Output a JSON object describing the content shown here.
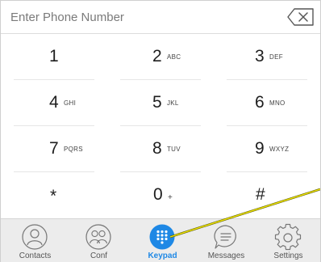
{
  "entry": {
    "placeholder": "Enter Phone Number",
    "value": "",
    "backspace_icon": "backspace-icon"
  },
  "keypad": {
    "keys": [
      {
        "digit": "1",
        "letters": ""
      },
      {
        "digit": "2",
        "letters": "ABC"
      },
      {
        "digit": "3",
        "letters": "DEF"
      },
      {
        "digit": "4",
        "letters": "GHI"
      },
      {
        "digit": "5",
        "letters": "JKL"
      },
      {
        "digit": "6",
        "letters": "MNO"
      },
      {
        "digit": "7",
        "letters": "PQRS"
      },
      {
        "digit": "8",
        "letters": "TUV"
      },
      {
        "digit": "9",
        "letters": "WXYZ"
      },
      {
        "digit": "*",
        "letters": ""
      },
      {
        "digit": "0",
        "letters": "+"
      },
      {
        "digit": "#",
        "letters": ""
      }
    ]
  },
  "tabbar": {
    "tabs": [
      {
        "label": "Contacts",
        "icon": "contact-icon",
        "active": false
      },
      {
        "label": "Conf",
        "icon": "conference-icon",
        "active": false
      },
      {
        "label": "Keypad",
        "icon": "keypad-icon",
        "active": true
      },
      {
        "label": "Messages",
        "icon": "message-icon",
        "active": false
      },
      {
        "label": "Settings",
        "icon": "gear-icon",
        "active": false
      }
    ]
  },
  "colors": {
    "accent": "#1e88e5",
    "tab_bg": "#ececec",
    "annotation": "#f2e600"
  }
}
